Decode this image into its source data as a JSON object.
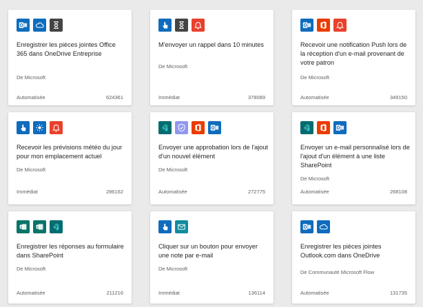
{
  "author_prefix": "De",
  "icon_colors": {
    "outlook": "#0f6cbd",
    "onedrive": "#0f6cbd",
    "schedule": "#444444",
    "mobile": "#0f6cbd",
    "notification": "#e8412c",
    "office": "#eb3c00",
    "weather": "#0f6cbd",
    "approvals": "#9097ef",
    "sharepoint": "#036c70",
    "forms": "#077568",
    "mail": "#0f8c9e"
  },
  "cards": [
    {
      "icons": [
        "outlook",
        "onedrive",
        "schedule"
      ],
      "title": "Enregistrer les pièces jointes Office 365 dans OneDrive Entreprise",
      "author": "De Microsoft",
      "type": "Automatisée",
      "count": "624361"
    },
    {
      "icons": [
        "mobile",
        "schedule",
        "notification"
      ],
      "title": "M'envoyer un rappel dans 10 minutes",
      "author": "De Microsoft",
      "type": "Immédiat",
      "count": "378089"
    },
    {
      "icons": [
        "outlook",
        "office",
        "notification"
      ],
      "title": "Recevoir une notification Push lors de la réception d'un e-mail provenant de votre patron",
      "author": "De Microsoft",
      "type": "Automatisée",
      "count": "349150"
    },
    {
      "icons": [
        "mobile",
        "weather",
        "notification"
      ],
      "title": "Recevoir les prévisions météo du jour pour mon emplacement actuel",
      "author": "De Microsoft",
      "type": "Immédiat",
      "count": "286162"
    },
    {
      "icons": [
        "sharepoint",
        "approvals",
        "office",
        "outlook"
      ],
      "title": "Envoyer une approbation lors de l'ajout d'un nouvel élément",
      "author": "De Microsoft",
      "type": "Automatisée",
      "count": "272775"
    },
    {
      "icons": [
        "sharepoint",
        "office",
        "outlook"
      ],
      "title": "Envoyer un e-mail personnalisé lors de l'ajout d'un élément à une liste SharePoint",
      "author": "De Microsoft",
      "type": "Automatisée",
      "count": "268108"
    },
    {
      "icons": [
        "forms",
        "forms",
        "sharepoint"
      ],
      "title": "Enregistrer les réponses au formulaire dans SharePoint",
      "author": "De Microsoft",
      "type": "Automatisée",
      "count": "211216"
    },
    {
      "icons": [
        "mobile",
        "mail"
      ],
      "title": "Cliquer sur un bouton pour envoyer une note par e-mail",
      "author": "De Microsoft",
      "type": "Immédiat",
      "count": "136114"
    },
    {
      "icons": [
        "outlook",
        "onedrive"
      ],
      "title": "Enregistrer les pièces jointes Outlook.com dans OneDrive",
      "author": "De Communauté Microsoft Flow",
      "type": "Automatisée",
      "count": "131735"
    }
  ]
}
